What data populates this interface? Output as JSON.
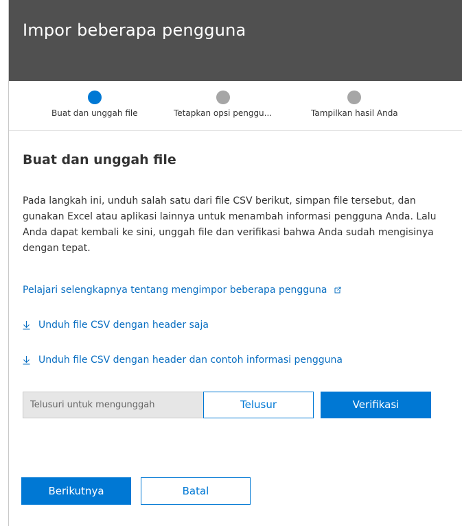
{
  "header": {
    "title": "Impor beberapa pengguna"
  },
  "steps": [
    {
      "label": "Buat dan unggah file",
      "state": "active"
    },
    {
      "label": "Tetapkan opsi penggu...",
      "state": "inactive"
    },
    {
      "label": "Tampilkan hasil Anda",
      "state": "inactive"
    }
  ],
  "section": {
    "title": "Buat dan unggah file",
    "description": "Pada langkah ini, unduh salah satu dari file CSV berikut, simpan file tersebut, dan gunakan Excel atau aplikasi lainnya untuk menambah informasi pengguna Anda. Lalu Anda dapat kembali ke sini, unggah file dan verifikasi bahwa Anda sudah mengisinya dengan tepat."
  },
  "links": {
    "learn_more": "Pelajari selengkapnya tentang mengimpor beberapa pengguna",
    "download_headers": "Unduh file CSV dengan header saja",
    "download_sample": "Unduh file CSV dengan header dan contoh informasi pengguna"
  },
  "upload": {
    "placeholder": "Telusuri untuk mengunggah",
    "browse_label": "Telusur",
    "verify_label": "Verifikasi"
  },
  "footer": {
    "next_label": "Berikutnya",
    "cancel_label": "Batal"
  },
  "colors": {
    "accent": "#0078d4",
    "header_bg": "#505050",
    "inactive_step": "#a6a6a6",
    "link": "#0a6fc2"
  },
  "icons": {
    "learn_more": "external-link-icon",
    "download": "download-icon"
  }
}
